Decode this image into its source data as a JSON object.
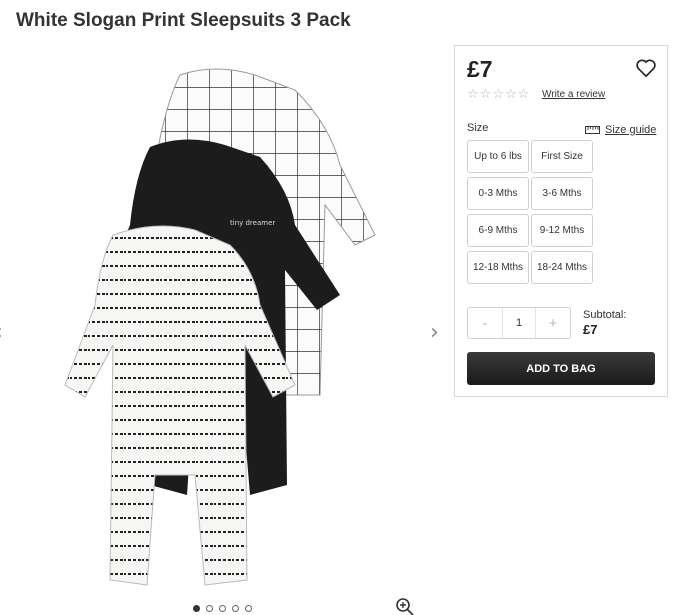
{
  "product": {
    "title": "White Slogan Print Sleepsuits 3 Pack",
    "price": "£7",
    "review_link": "Write a review",
    "rating_stars": 0,
    "rating_max": 5
  },
  "size": {
    "label": "Size",
    "guide_label": "Size guide",
    "options": [
      "Up to 6 lbs",
      "First Size",
      "0-3 Mths",
      "3-6 Mths",
      "6-9 Mths",
      "9-12 Mths",
      "12-18 Mths",
      "18-24 Mths"
    ]
  },
  "quantity": {
    "minus": "-",
    "value": "1",
    "plus": "+"
  },
  "subtotal": {
    "label": "Subtotal:",
    "value": "£7"
  },
  "actions": {
    "add_to_bag": "ADD TO BAG"
  },
  "gallery": {
    "prev_icon": "chevron-left-icon",
    "next_icon": "chevron-right-icon",
    "zoom_icon": "zoom-in-icon",
    "image_count": 5,
    "active_index": 0
  },
  "colors": {
    "button_bg": "#222222",
    "star": "#b5b5b5",
    "border": "#d8d8d8"
  }
}
